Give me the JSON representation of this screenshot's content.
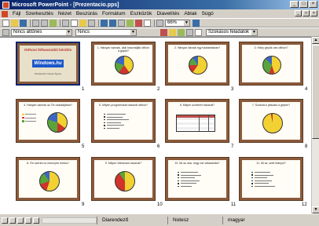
{
  "window": {
    "title": "Microsoft PowerPoint - [Prezentacio.pps]",
    "app_icon": "powerpoint-icon",
    "buttons": [
      "_",
      "□",
      "×"
    ]
  },
  "menubar": {
    "items": [
      "Fájl",
      "Szerkesztés",
      "Nézet",
      "Beszúrás",
      "Formátum",
      "Eszközök",
      "Diavetítés",
      "Ablak",
      "Súgó"
    ],
    "doc_buttons": [
      "_",
      "□",
      "×"
    ]
  },
  "toolbar1": {
    "zoom": "66%"
  },
  "toolbar2": {
    "transition": "Nincs áttűnés",
    "effect": "Nincs",
    "task": "Szokásos feladatok"
  },
  "slides": [
    {
      "num": "1",
      "title": "Otthoni felhasználói kérdőív",
      "logo": "Windows.hu",
      "subtitle": "Szerkesztő: Nevek Ágnes"
    },
    {
      "num": "2",
      "title": "1. Hányan vannak, akik használják otthon a gépet?"
    },
    {
      "num": "3",
      "title": "2. Hányan laknak egy háztartásban?"
    },
    {
      "num": "4",
      "title": "3. Hány gépük van otthon?"
    },
    {
      "num": "5",
      "title": "4. Hányan vannak az Ön családjában?"
    },
    {
      "num": "6",
      "title": "5. Milyen programokat használ otthon?"
    },
    {
      "num": "7",
      "title": "6. Milyen szoftvert használ?"
    },
    {
      "num": "8",
      "title": "7. Szokott-e játszani a gépen?"
    },
    {
      "num": "9",
      "title": "8. Ön szerint ez mennyire fontos?"
    },
    {
      "num": "10",
      "title": "9. Milyen Windowst használ?"
    },
    {
      "num": "11",
      "title": "10. Mi az oka, hogy ezt választotta?"
    },
    {
      "num": "12",
      "title": "11. Mi az, amit hiányol?"
    }
  ],
  "statusbar": {
    "view": "Diarendező",
    "design": "Notesz",
    "language": "magyar"
  },
  "colors": {
    "slide_frame": "#8a5a3b",
    "pie_yellow": "#f2d233",
    "pie_red": "#d0342c",
    "pie_green": "#5aa43c",
    "pie_blue": "#3b66c4"
  }
}
